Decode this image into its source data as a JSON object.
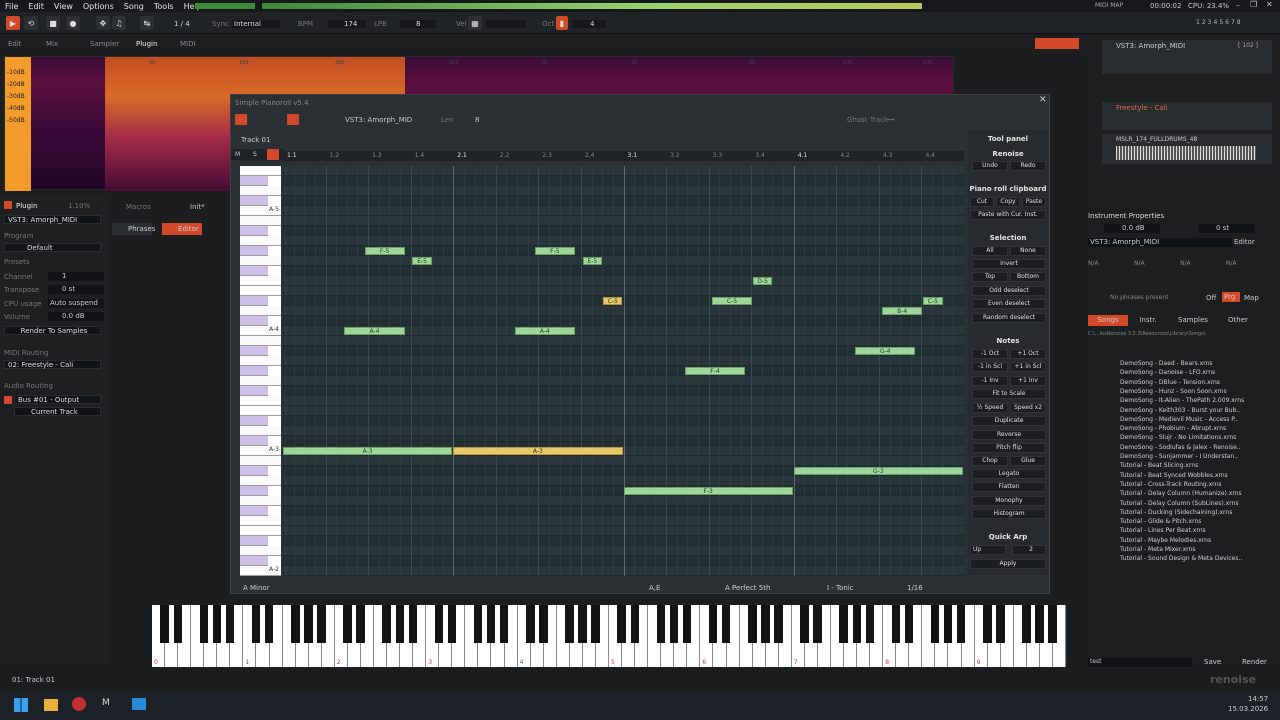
{
  "menu": [
    "File",
    "Edit",
    "View",
    "Options",
    "Song",
    "Tools",
    "Help"
  ],
  "status": {
    "midi_map": "MIDI MAP",
    "time": "00:00:02",
    "cpu": "CPU: 23.4%"
  },
  "transport": {
    "lines": "1 / 4",
    "sync_label": "Sync",
    "sync_value": "Internal",
    "bpm_label": "BPM",
    "bpm": "174",
    "lpb_label": "LPB",
    "lpb": "8",
    "vel_label": "Vel",
    "oct_label": "Oct",
    "oct": "4",
    "track_numbers": [
      "1",
      "2",
      "3",
      "4",
      "5",
      "6",
      "7",
      "8"
    ]
  },
  "tabs": [
    "Edit",
    "Mix",
    "Sampler",
    "Plugin",
    "MIDI"
  ],
  "spectrum": {
    "db_labels": [
      "-10dB",
      "-20dB",
      "-30dB",
      "-40dB",
      "-50dB"
    ],
    "freq_labels": [
      "50",
      "100",
      "200",
      "500",
      "1K",
      "2K",
      "5K",
      "10K",
      "20K"
    ]
  },
  "left": {
    "plugin_tab": "Plugin",
    "percent": "1.10%",
    "macros": "Macros",
    "init": "Init*",
    "plugin_name": "VST3: Amorph_MIDI",
    "program_label": "Program",
    "program": "Default",
    "presets_label": "Presets",
    "channel_label": "Channel",
    "channel": "1",
    "transpose_label": "Transpose",
    "transpose": "0 st",
    "cpu_label": "CPU usage",
    "auto_suspend": "Auto suspend",
    "volume_label": "Volume",
    "volume": "0.0 dB",
    "render_btn": "Render To Samples",
    "midi_routing": "MIDI Routing",
    "midi_out": "02: Freestyle - Cali",
    "audio_routing": "Audio Routing",
    "bus": "Bus #01 - Output",
    "current_track": "Current Track",
    "phrases": "Phrases",
    "editor": "Editor"
  },
  "pianoroll": {
    "title": "Simple Pianoroll v5.4",
    "instrument": "VST3: Amorph_MID",
    "len_label": "Len",
    "len": "8",
    "ghost_label": "Ghost Track",
    "ghost_value": "---",
    "track": "Track 01",
    "bar_labels": [
      "1.1",
      "1.2",
      "1.3",
      "1.4",
      "2.1",
      "2.2",
      "2.3",
      "2.4",
      "3.1",
      "3.2",
      "3.3",
      "3.4",
      "4.1",
      "4.2",
      "4.3",
      "4.4"
    ],
    "keys": [
      "A-5",
      "A-4",
      "A-3",
      "A-2"
    ],
    "notes": [
      {
        "label": "F-5",
        "start": 0.12,
        "len": 0.06,
        "row": 8,
        "sel": false
      },
      {
        "label": "E-5",
        "start": 0.19,
        "len": 0.03,
        "row": 9,
        "sel": false
      },
      {
        "label": "F-5",
        "start": 0.37,
        "len": 0.06,
        "row": 8,
        "sel": false
      },
      {
        "label": "E-5",
        "start": 0.44,
        "len": 0.03,
        "row": 9,
        "sel": false
      },
      {
        "label": "D-5",
        "start": 0.69,
        "len": 0.03,
        "row": 11,
        "sel": false
      },
      {
        "label": "C-5",
        "start": 0.47,
        "len": 0.03,
        "row": 13,
        "sel": true
      },
      {
        "label": "C-5",
        "start": 0.63,
        "len": 0.06,
        "row": 13,
        "sel": false
      },
      {
        "label": "C-5",
        "start": 0.94,
        "len": 0.03,
        "row": 13,
        "sel": false
      },
      {
        "label": "B-4",
        "start": 0.88,
        "len": 0.06,
        "row": 14,
        "sel": false
      },
      {
        "label": "A-4",
        "start": 0.09,
        "len": 0.09,
        "row": 16,
        "sel": false
      },
      {
        "label": "A-4",
        "start": 0.34,
        "len": 0.09,
        "row": 16,
        "sel": false
      },
      {
        "label": "G-4",
        "start": 0.84,
        "len": 0.09,
        "row": 18,
        "sel": false
      },
      {
        "label": "F-4",
        "start": 0.59,
        "len": 0.09,
        "row": 20,
        "sel": false
      },
      {
        "label": "A-3",
        "start": 0.0,
        "len": 0.25,
        "row": 28,
        "sel": false
      },
      {
        "label": "A-3",
        "start": 0.25,
        "len": 0.25,
        "row": 28,
        "sel": true
      },
      {
        "label": "G-3",
        "start": 0.75,
        "len": 0.25,
        "row": 30,
        "sel": false
      },
      {
        "label": "F-3",
        "start": 0.5,
        "len": 0.25,
        "row": 32,
        "sel": false
      }
    ],
    "footer": {
      "scale": "A Minor",
      "chord": "A,E",
      "interval": "A Perfect 5th",
      "degree": "I - Tonic",
      "grid": "1/16"
    }
  },
  "toolpanel": {
    "title": "Tool panel",
    "renoise": "Renoise",
    "undo": "Undo",
    "redo": "Redo",
    "clipboard": "Piano roll clipboard",
    "cut": "Cut",
    "copy": "Copy",
    "paste": "Paste",
    "paste_cur": "Paste with Cur. Inst.",
    "selection": "Selection",
    "all": "All",
    "none": "None",
    "invert": "Invert",
    "top": "Top",
    "bottom": "Bottom",
    "odd": "Odd deselect",
    "even": "Even deselect",
    "random": "Random deselect",
    "notes": "Notes",
    "m1oct": "-1 Oct",
    "p1oct": "+1 Oct",
    "m1scl": "-1 in Scl",
    "p1scl": "+1 in Scl",
    "m1inv": "-1 Inv",
    "p1inv": "+1 Inv",
    "fit": "Fit to Scale",
    "halfspeed": "½ Speed",
    "speedx2": "Speed x2",
    "duplicate": "Duplicate",
    "reverse": "Reverse",
    "pitchflip": "Pitch flip",
    "chop": "Chop",
    "glue": "Glue",
    "legato": "Legato",
    "flatten": "Flatten",
    "monophy": "Monophy",
    "histogram": "Histogram",
    "quickarp": "Quick Arp",
    "up": "Up",
    "arp_val": "2",
    "apply": "Apply"
  },
  "right": {
    "inst1": "VST3: Amorph_MIDI",
    "inst1_num": "[ 102 ]",
    "inst2": "Freestyle - Cali",
    "inst3": "MSLR_174_FULLDRUMS_48",
    "inst_props": "Instrument Properties",
    "vol": "0.0 dB",
    "tr": "0 st",
    "inst_name": "VST3: Amorph_MIDI",
    "editor": "Editor",
    "na": "N/A",
    "no_phrases": "No phrases present",
    "off": "Off",
    "prg": "Prg",
    "map": "Map",
    "browser_tabs": [
      "Songs",
      "Instr.",
      "Samples",
      "Other"
    ],
    "path": "C:\\...lesRenoise 3.5.3\\Resources\\Library\\Songs\\",
    "files": [
      "DemoSong - Daed - Bears.xrns",
      "DemoSong - Danoise - LFO.xrns",
      "DemoSong - DBlue - Tension.xrns",
      "DemoSong - Hunz - Soon Soon.xrns",
      "DemoSong - It-Alien - ThePath 2.009.xrns",
      "DemoSong - Keith303 - Burst your Bub..",
      "DemoSong - Medievil Music - Access P..",
      "DemoSong - Phobium - Abrupt.xrns",
      "DemoSong - Slujr - No Limitations.xrns",
      "DemoSong - Sodiufas & Jalex - Renoise..",
      "DemoSong - Sunjammer - I Understan..",
      "Tutorial - Beat Slicing.xrns",
      "Tutorial - Beat Synced Wobbles.xrns",
      "Tutorial - Cross-Track Routing.xrns",
      "Tutorial - Delay Column (Humanize).xrns",
      "Tutorial - Delay Column (SubLines).xrns",
      "Tutorial - Ducking (Sidechaining).xrns",
      "Tutorial - Glide & Pitch.xrns",
      "Tutorial - Lines Per Beat.xrns",
      "Tutorial - Maybe Melodies.xrns",
      "Tutorial - Meta Mixer.xrns",
      "Tutorial - Sound Design & Meta Devices.."
    ],
    "search": "test",
    "save": "Save",
    "render": "Render"
  },
  "keyboard_octaves": [
    "0",
    "1",
    "2",
    "3",
    "4",
    "5",
    "6",
    "7",
    "8",
    "9"
  ],
  "statusbar": {
    "track": "01: Track 01",
    "logo": "renoise"
  },
  "taskbar": {
    "time": "14:57",
    "date": "15.03.2026"
  },
  "colors": {
    "note": "#9ed69a",
    "note_selected": "#e6c76a",
    "accent": "#e04a2f"
  }
}
